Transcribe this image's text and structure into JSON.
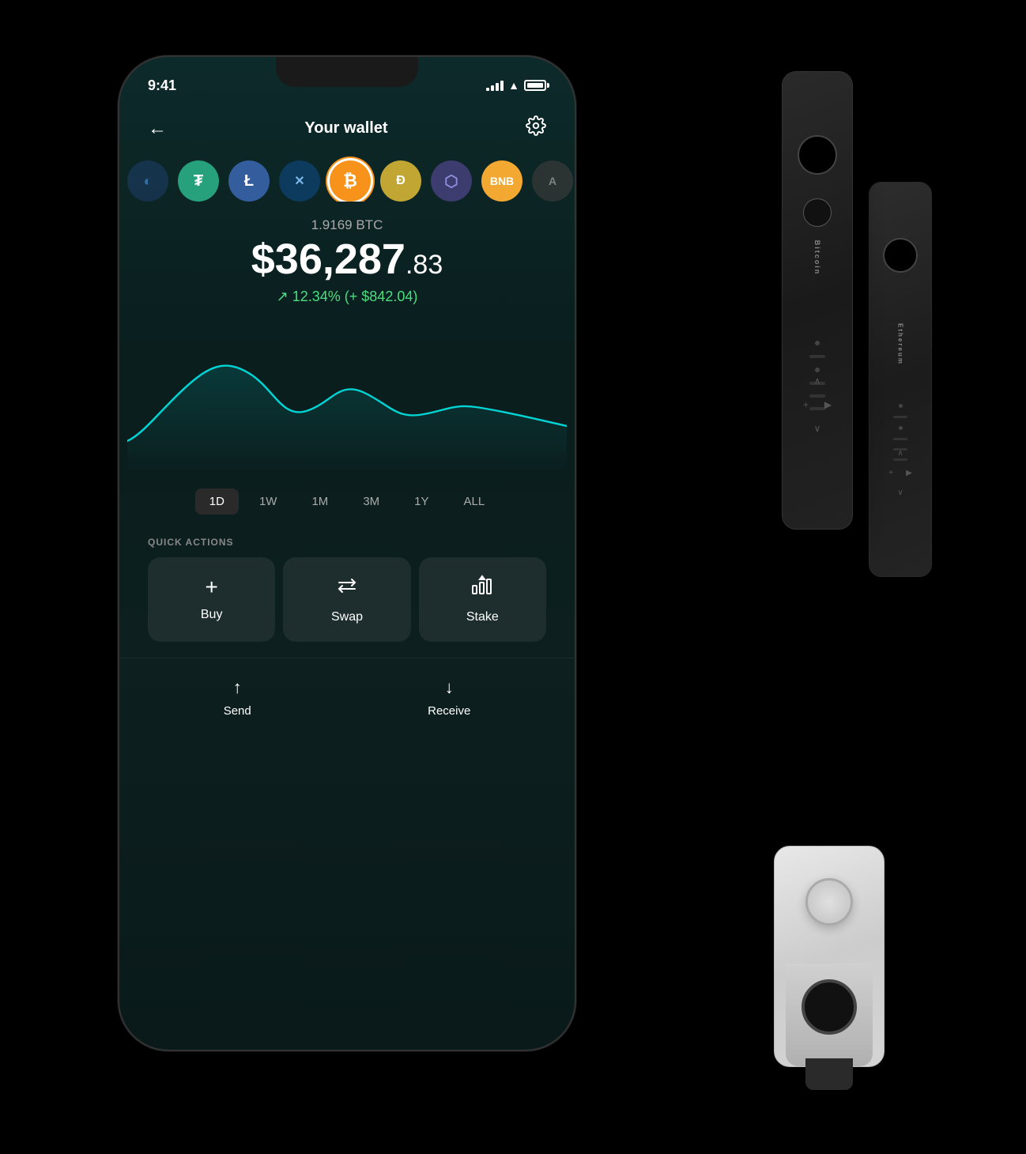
{
  "status_bar": {
    "time": "9:41"
  },
  "header": {
    "title": "Your wallet",
    "back_label": "←",
    "settings_label": "⚙"
  },
  "coins": [
    {
      "symbol": "?",
      "bg": "#1a3a5c",
      "color": "#4a90d9",
      "label": "partial"
    },
    {
      "symbol": "₮",
      "bg": "#26a17b",
      "color": "#fff",
      "label": "USDT"
    },
    {
      "symbol": "Ł",
      "bg": "#345d9d",
      "color": "#fff",
      "label": "LTC"
    },
    {
      "symbol": "✕",
      "bg": "#0d3b5e",
      "color": "#7ab7e8",
      "label": "XRP"
    },
    {
      "symbol": "₿",
      "bg": "#f7931a",
      "color": "#fff",
      "label": "BTC"
    },
    {
      "symbol": "Ð",
      "bg": "#c2a633",
      "color": "#fff",
      "label": "DOGE"
    },
    {
      "symbol": "Ξ",
      "bg": "#3c3c6e",
      "color": "#8c8cdb",
      "label": "ETH"
    },
    {
      "symbol": "B",
      "bg": "#f3a832",
      "color": "#fff",
      "label": "BNB"
    },
    {
      "symbol": "A",
      "bg": "#555",
      "color": "#aaa",
      "label": "partial2"
    }
  ],
  "balance": {
    "crypto_amount": "1.9169 BTC",
    "fiat_main": "$36,287",
    "fiat_cents": ".83",
    "change_text": "↗ 12.34% (+ $842.04)"
  },
  "time_filters": [
    {
      "label": "1D",
      "active": true
    },
    {
      "label": "1W",
      "active": false
    },
    {
      "label": "1M",
      "active": false
    },
    {
      "label": "3M",
      "active": false
    },
    {
      "label": "1Y",
      "active": false
    },
    {
      "label": "ALL",
      "active": false
    }
  ],
  "quick_actions": {
    "label": "QUICK ACTIONS",
    "buttons": [
      {
        "icon": "+",
        "label": "Buy"
      },
      {
        "icon": "⇄",
        "label": "Swap"
      },
      {
        "icon": "↑↑",
        "label": "Stake"
      }
    ]
  },
  "bottom_nav": [
    {
      "icon": "↑",
      "label": "Send"
    },
    {
      "icon": "↓",
      "label": "Receive"
    }
  ],
  "hardware": {
    "wallet1_text": "Bitcoin",
    "wallet2_text": "Ethereum"
  }
}
